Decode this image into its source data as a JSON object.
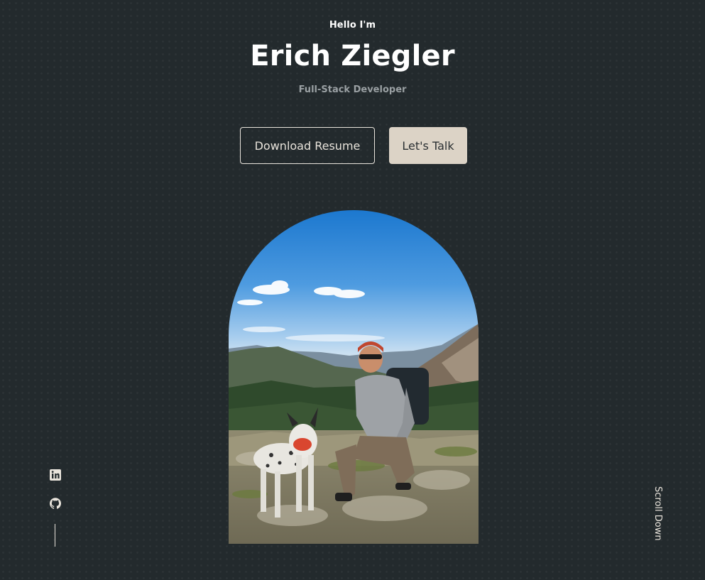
{
  "hero": {
    "greeting": "Hello I'm",
    "name": "Erich Ziegler",
    "role": "Full-Stack Developer",
    "buttons": {
      "download_label": "Download Resume",
      "talk_label": "Let's Talk"
    },
    "photo": {
      "subject": "hiker-with-dog-on-mountain"
    }
  },
  "socials": {
    "items": [
      {
        "icon": "linkedin-icon"
      },
      {
        "icon": "github-icon"
      }
    ]
  },
  "scroll": {
    "label": "Scroll Down"
  },
  "colors": {
    "background": "#232a2d",
    "accent": "#dcd3c6",
    "text_muted": "#9aa0a3",
    "outline": "#e9e4dc"
  }
}
